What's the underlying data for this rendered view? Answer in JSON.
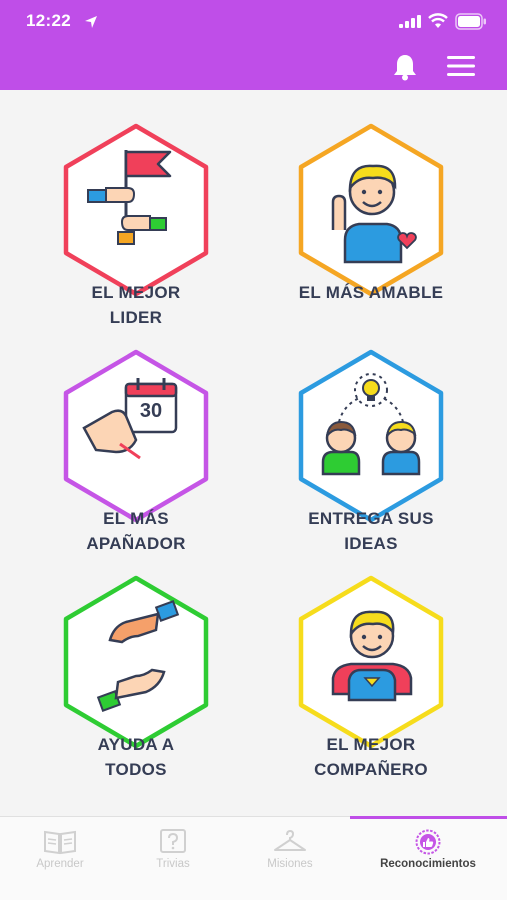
{
  "status_bar": {
    "time": "12:22"
  },
  "badges": [
    {
      "label_line1": "EL MEJOR",
      "label_line2": "LIDER",
      "hex_color": "#f0405a"
    },
    {
      "label_line1": "EL MÁS AMABLE",
      "label_line2": "",
      "hex_color": "#f5a623"
    },
    {
      "label_line1": "EL MÁS",
      "label_line2": "APAÑADOR",
      "hex_color": "#c555e6"
    },
    {
      "label_line1": "ENTREGA SUS",
      "label_line2": "IDEAS",
      "hex_color": "#2c9be0"
    },
    {
      "label_line1": "AYUDA A",
      "label_line2": "TODOS",
      "hex_color": "#2ecc33"
    },
    {
      "label_line1": "EL MEJOR",
      "label_line2": "COMPAÑERO",
      "hex_color": "#f6dc1c"
    }
  ],
  "calendar_number": "30",
  "tabs": [
    {
      "label": "Aprender",
      "icon": "book-icon",
      "active": false
    },
    {
      "label": "Trivias",
      "icon": "question-icon",
      "active": false
    },
    {
      "label": "Misiones",
      "icon": "hanger-icon",
      "active": false
    },
    {
      "label": "Reconocimientos",
      "icon": "thumbs-up-badge-icon",
      "active": true
    }
  ],
  "colors": {
    "accent": "#bf4ee8",
    "label_text": "#353d55",
    "inactive_tab": "#c8c8c8"
  }
}
